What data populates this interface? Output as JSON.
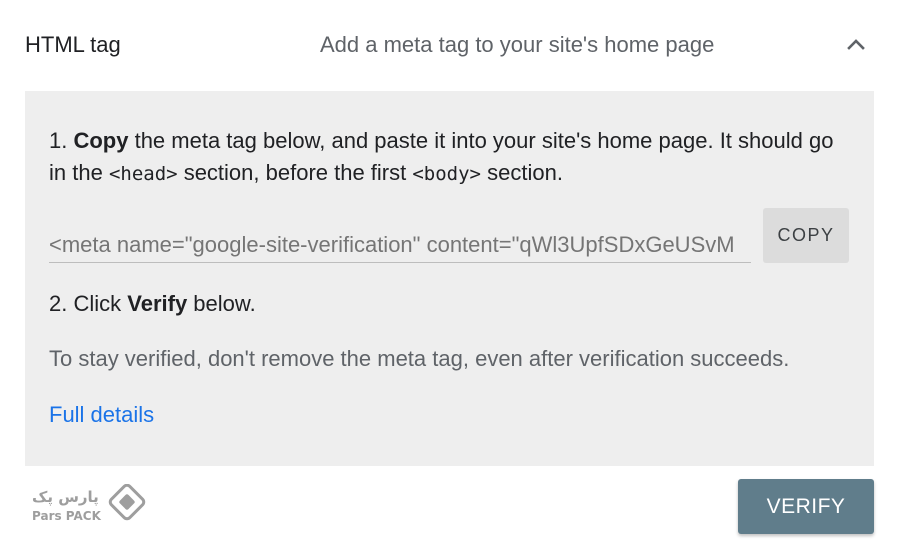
{
  "header": {
    "method_title": "HTML tag",
    "method_description": "Add a meta tag to your site's home page",
    "collapse_icon": "chevron-up-icon"
  },
  "instructions": {
    "step1_prefix": "1. ",
    "step1_bold": "Copy",
    "step1_text_a": " the meta tag below, and paste it into your site's home page. It should go in the ",
    "step1_code_head": "<head>",
    "step1_text_b": " section, before the first ",
    "step1_code_body": "<body>",
    "step1_text_c": " section.",
    "meta_tag_value": "<meta name=\"google-site-verification\" content=\"qWl3UpfSDxGeUSvM",
    "copy_label": "COPY",
    "step2_prefix": "2. Click ",
    "step2_bold": "Verify",
    "step2_suffix": " below.",
    "note": "To stay verified, don't remove the meta tag, even after verification succeeds.",
    "details_link": "Full details"
  },
  "footer": {
    "logo_text_fa": "پارس پک",
    "logo_text_en": "Pars PACK",
    "verify_label": "VERIFY"
  },
  "colors": {
    "panel_bg": "#eeeeee",
    "link": "#1a73e8",
    "verify_button": "#607d8b",
    "copy_button": "#dcdcdc"
  }
}
